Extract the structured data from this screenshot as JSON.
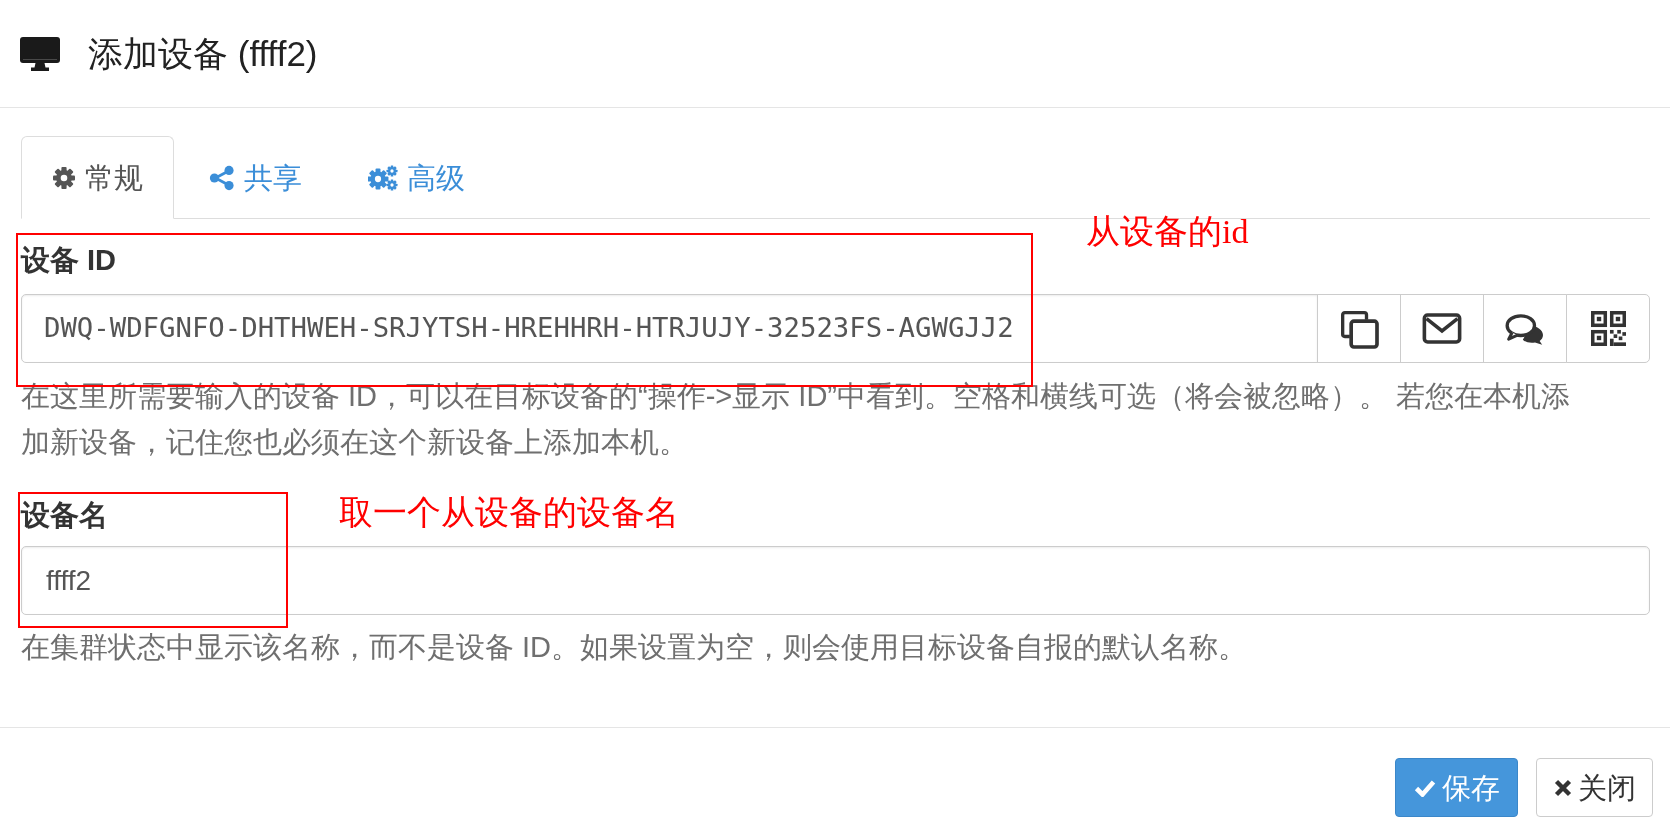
{
  "dialog": {
    "title": "添加设备 (ffff2)"
  },
  "tabs": [
    {
      "label": "常规",
      "selected": true
    },
    {
      "label": "共享",
      "selected": false
    },
    {
      "label": "高级",
      "selected": false
    }
  ],
  "device_id": {
    "label": "设备 ID",
    "value": "DWQ-WDFGNFO-DHTHWEH-SRJYTSH-HREHHRH-HTRJUJY-32523FS-AGWGJJ2",
    "help": "在这里所需要输入的设备 ID，可以在目标设备的“操作->显示 ID”中看到。空格和横线可选（将会被忽略）。 若您在本机添加新设备，记住您也必须在这个新设备上添加本机。"
  },
  "device_name": {
    "label": "设备名",
    "value": "ffff2",
    "help": "在集群状态中显示该名称，而不是设备 ID。如果设置为空，则会使用目标设备自报的默认名称。"
  },
  "buttons": [
    {
      "label": "保存",
      "kind": "primary"
    },
    {
      "label": "关闭",
      "kind": "default"
    }
  ],
  "annotations": [
    {
      "text": "从设备的id"
    },
    {
      "text": "取一个从设备的设备名"
    }
  ]
}
